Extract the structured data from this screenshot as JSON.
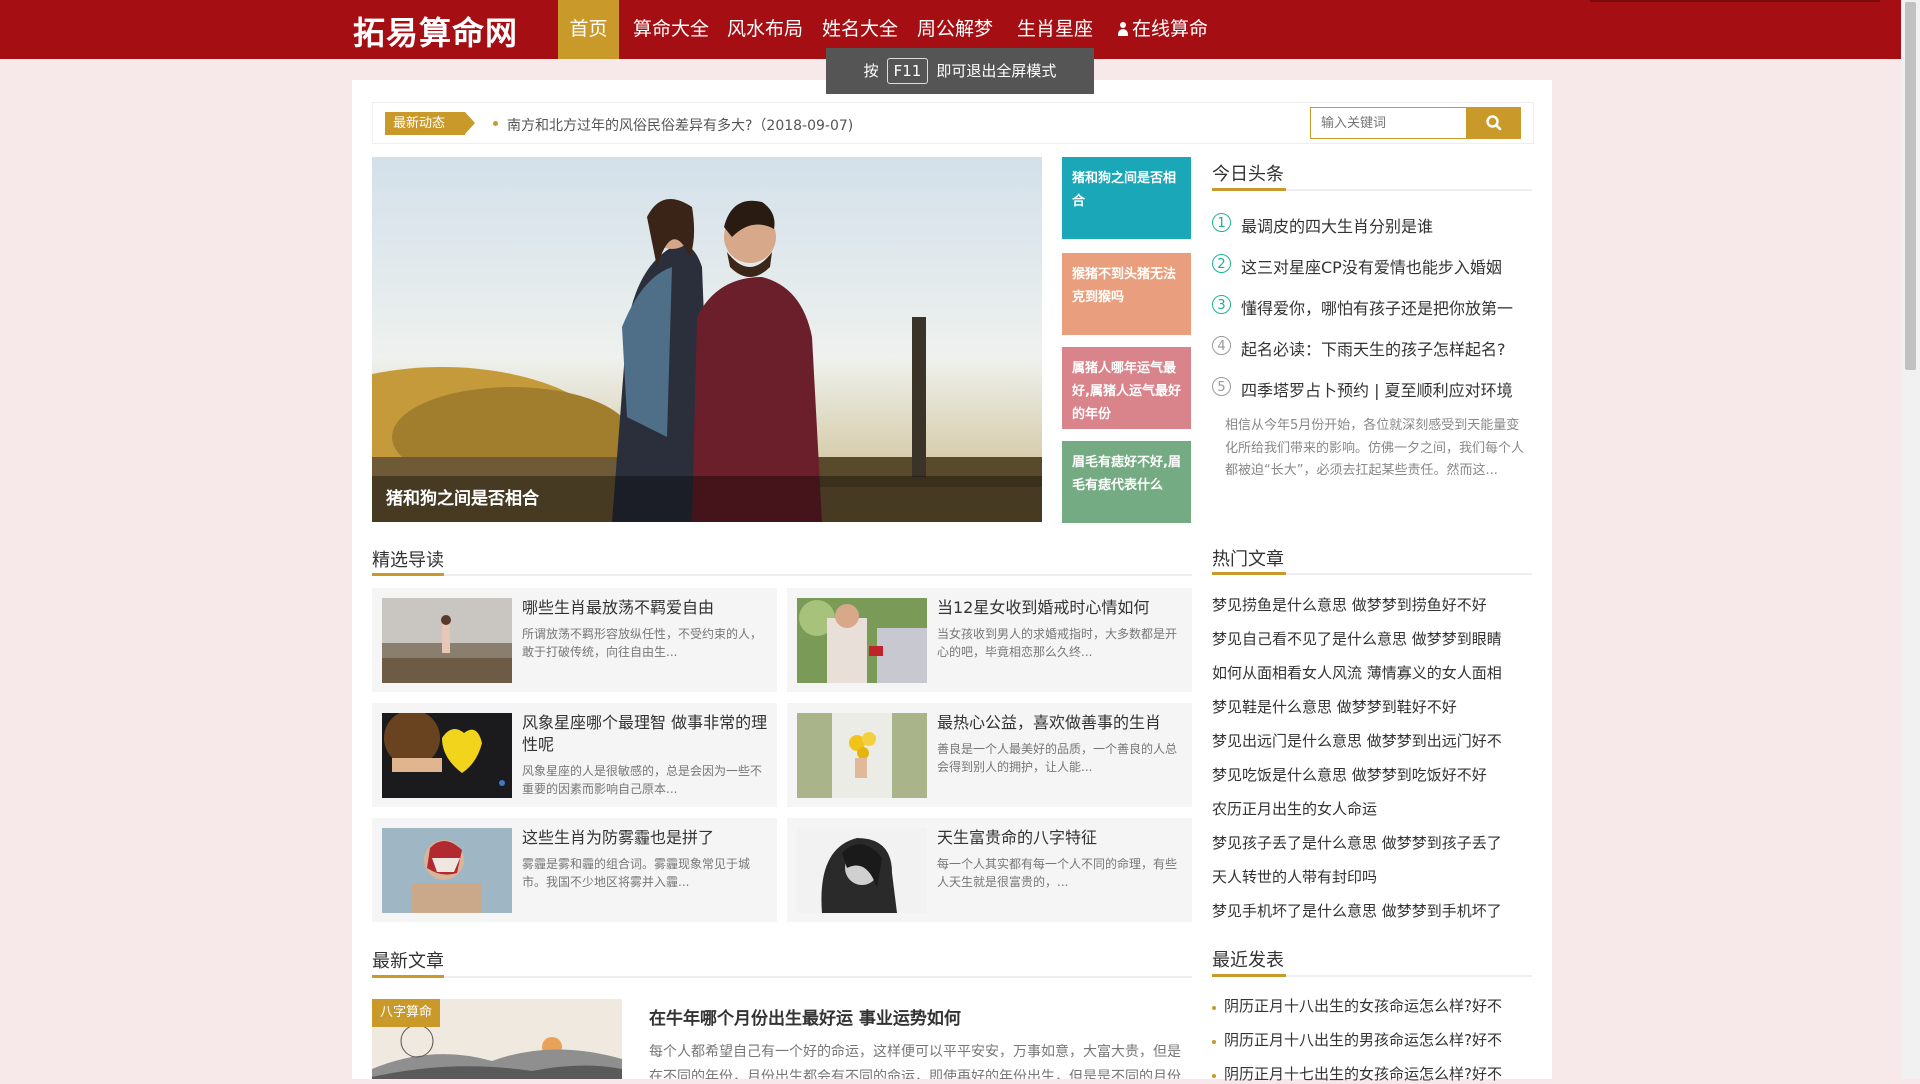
{
  "nav": {
    "logo": "拓易算命网",
    "items": [
      {
        "label": "首页",
        "active": true
      },
      {
        "label": "算命大全"
      },
      {
        "label": "风水布局"
      },
      {
        "label": "姓名大全"
      },
      {
        "label": "周公解梦"
      },
      {
        "label": "生肖星座"
      },
      {
        "label": "在线算命",
        "icon": "user-icon"
      }
    ]
  },
  "fullscreen_toast": {
    "prefix": "按",
    "key": "F11",
    "suffix": "即可退出全屏模式"
  },
  "news": {
    "tag": "最新动态",
    "text": "南方和北方过年的风俗民俗差异有多大?（2018-09-07)"
  },
  "search": {
    "placeholder": "输入关键词",
    "icon": "search-icon"
  },
  "hero": {
    "caption": "猪和狗之间是否相合"
  },
  "tiles": [
    {
      "text": "猪和狗之间是否相合",
      "color": "#1aa7b8"
    },
    {
      "text": "猴猪不到头猪无法克到猴吗",
      "color": "#e99f7d"
    },
    {
      "text": "属猪人哪年运气最好,属猪人运气最好的年份",
      "color": "#d9838b"
    },
    {
      "text": "眉毛有痣好不好,眉毛有痣代表什么",
      "color": "#75ab82"
    }
  ],
  "today": {
    "title": "今日头条",
    "items": [
      {
        "num": "1",
        "text": "最调皮的四大生肖分别是谁"
      },
      {
        "num": "2",
        "text": "这三对星座CP没有爱情也能步入婚姻"
      },
      {
        "num": "3",
        "text": "懂得爱你，哪怕有孩子还是把你放第一"
      },
      {
        "num": "4",
        "text": "起名必读：下雨天生的孩子怎样起名?"
      },
      {
        "num": "5",
        "text": "四季塔罗占卜预约 | 夏至顺利应对环境"
      }
    ],
    "excerpt": "相信从今年5月份开始，各位就深刻感受到天能量变化所给我们带来的影响。仿佛一夕之间，我们每个人都被迫“长大”，必须去扛起某些责任。然而这..."
  },
  "featured": {
    "title": "精选导读",
    "cards": [
      {
        "title": "哪些生肖最放荡不羁爱自由",
        "desc": "所谓放荡不羁形容放纵任性，不受约束的人，敢于打破传统，向往自由生...",
        "img": "beach-girl"
      },
      {
        "title": "当12星女收到婚戒时心情如何",
        "desc": "当女孩收到男人的求婚戒指时，大多数都是开心的吧，毕竟相恋那么久终...",
        "img": "ring-proposal"
      },
      {
        "title": "风象星座哪个最理智 做事非常的理性呢",
        "desc": "风象星座的人是很敏感的，总是会因为一些不重要的因素而影响自己原本...",
        "img": "yellow-heart"
      },
      {
        "title": "最热心公益，喜欢做善事的生肖",
        "desc": "善良是一个人最美好的品质，一个善良的人总会得到别人的拥护，让人能...",
        "img": "flowers"
      },
      {
        "title": "这些生肖为防雾霾也是拼了",
        "desc": "雾霾是雾和霾的组合词。雾霾现象常见于城市。我国不少地区将雾并入霾...",
        "img": "mask-man"
      },
      {
        "title": "天生富贵命的八字特征",
        "desc": "每一个人其实都有每一个人不同的命理，有些人天生就是很富贵的，...",
        "img": "woman-portrait"
      }
    ]
  },
  "hot": {
    "title": "热门文章",
    "items": [
      "梦见捞鱼是什么意思 做梦梦到捞鱼好不好",
      "梦见自己看不见了是什么意思 做梦梦到眼睛",
      "如何从面相看女人风流 薄情寡义的女人面相",
      "梦见鞋是什么意思 做梦梦到鞋好不好",
      "梦见出远门是什么意思 做梦梦到出远门好不",
      "梦见吃饭是什么意思 做梦梦到吃饭好不好",
      "农历正月出生的女人命运",
      "梦见孩子丢了是什么意思 做梦梦到孩子丢了",
      "天人转世的人带有封印吗",
      "梦见手机坏了是什么意思 做梦梦到手机坏了"
    ]
  },
  "latest": {
    "title": "最新文章",
    "tag": "八字算命",
    "headline": "在牛年哪个月份出生最好运 事业运势如何",
    "excerpt": "每个人都希望自己有一个好的命运，这样便可以平平安安，万事如意，大富大贵，但是在不同的年份，月份出生都会有不同的命运，即使再好的年份出生，但是是不同的月份"
  },
  "recent": {
    "title": "最近发表",
    "items": [
      "阴历正月十八出生的女孩命运怎么样?好不",
      "阴历正月十八出生的男孩命运怎么样?好不",
      "阴历正月十七出生的女孩命运怎么样?好不"
    ]
  },
  "colors": {
    "nav_bg": "#a50e13",
    "accent": "#c99a29",
    "page_bg": "#f7e9e9"
  }
}
